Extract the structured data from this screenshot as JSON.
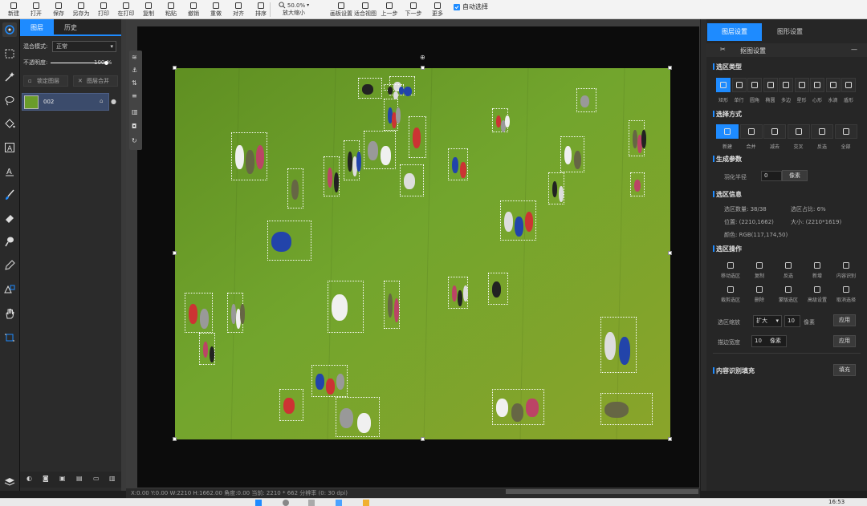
{
  "toolbar": {
    "items": [
      {
        "icon": "new-file-icon",
        "label": "新建"
      },
      {
        "icon": "open-folder-icon",
        "label": "打开"
      },
      {
        "icon": "save-icon",
        "label": "保存"
      },
      {
        "icon": "save-as-icon",
        "label": "另存为"
      },
      {
        "icon": "print-icon",
        "label": "打印"
      },
      {
        "icon": "stamp-icon",
        "label": "在打印"
      },
      {
        "icon": "copy-icon",
        "label": "复制"
      },
      {
        "icon": "paste-icon",
        "label": "粘贴"
      },
      {
        "icon": "undo-icon",
        "label": "撤销"
      },
      {
        "icon": "redo-icon",
        "label": "重做"
      },
      {
        "icon": "align-icon",
        "label": "对齐"
      },
      {
        "icon": "arrange-icon",
        "label": "排序"
      }
    ],
    "zoom_value": "50.0%",
    "zoom_label": "放大缩小",
    "items_right": [
      {
        "icon": "canvas-size-icon",
        "label": "画板设置"
      },
      {
        "icon": "zoom-fit-icon",
        "label": "适合视图"
      },
      {
        "icon": "prev-step-icon",
        "label": "上一步"
      },
      {
        "icon": "next-step-icon",
        "label": "下一步"
      },
      {
        "icon": "more-icon",
        "label": "更多"
      }
    ],
    "auto_select_label": "自动选择"
  },
  "layers_panel": {
    "tabs": [
      "图层",
      "历史"
    ],
    "blend_label": "混合模式:",
    "blend_value": "正常",
    "opacity_label": "不透明度:",
    "opacity_value": "100 %",
    "opacity_fraction": 1.0,
    "lock_button": "锁定图层",
    "merge_button": "图层合并",
    "layer_name": "002"
  },
  "status_bar": {
    "text": "X:0.00 Y:0.00 W:2210 H:1662.00 角度:0.00  当前: 2210 * 662 分辨率 (0: 30 dpi)"
  },
  "right_panel": {
    "tabs": [
      "图层设置",
      "图形设置"
    ],
    "panel_title": "抠图设置",
    "section_shape": "选区类型",
    "shapes": [
      {
        "icon": "rect-select-icon",
        "label": "矩形"
      },
      {
        "icon": "row-select-icon",
        "label": "单行"
      },
      {
        "icon": "round-rect-icon",
        "label": "圆角"
      },
      {
        "icon": "ellipse-icon",
        "label": "椭圆"
      },
      {
        "icon": "diamond-icon",
        "label": "多边"
      },
      {
        "icon": "star-icon",
        "label": "星形"
      },
      {
        "icon": "heart-icon",
        "label": "心形"
      },
      {
        "icon": "drop-icon",
        "label": "水滴"
      },
      {
        "icon": "shield-icon",
        "label": "盾形"
      }
    ],
    "section_mode": "选择方式",
    "modes": [
      {
        "icon": "new-select-icon",
        "label": "新建"
      },
      {
        "icon": "add-select-icon",
        "label": "合并"
      },
      {
        "icon": "sub-select-icon",
        "label": "减去"
      },
      {
        "icon": "intersect-icon",
        "label": "交叉"
      },
      {
        "icon": "xor-icon",
        "label": "反选"
      },
      {
        "icon": "union-icon",
        "label": "全部"
      }
    ],
    "section_params": "生成参数",
    "feather_label": "羽化半径",
    "feather_value": "0",
    "feather_unit": "像素",
    "section_info": "选区信息",
    "info": [
      "选区数量: 38/38",
      "选区占比: 6%",
      "位置: (2210,1662)",
      "大小: (2210*1619)",
      "颜色: RGB(117,174,50)"
    ],
    "section_ops": "选区操作",
    "ops": [
      {
        "icon": "move-icon",
        "label": "移动选区"
      },
      {
        "icon": "copy-sel-icon",
        "label": "复制"
      },
      {
        "icon": "invert-icon",
        "label": "反选"
      },
      {
        "icon": "add-op-icon",
        "label": "新增"
      },
      {
        "icon": "target-icon",
        "label": "内容识别"
      },
      {
        "icon": "crop-icon",
        "label": "裁剪选区"
      },
      {
        "icon": "trash-icon",
        "label": "删除"
      },
      {
        "icon": "mask-icon",
        "label": "蒙版选区"
      },
      {
        "icon": "gear-icon",
        "label": "高级设置"
      },
      {
        "icon": "close-sel-icon",
        "label": "取消选择"
      }
    ],
    "expand_label": "选区缩放",
    "expand_select": "扩大",
    "expand_value": "10",
    "expand_unit": "像素",
    "expand_apply": "应用",
    "border_label": "描边宽度",
    "border_value": "10",
    "border_unit": "像素",
    "border_apply": "应用",
    "section_content": "内容识别填充",
    "content_button": "填充"
  },
  "taskbar": {
    "time": "16:53"
  }
}
